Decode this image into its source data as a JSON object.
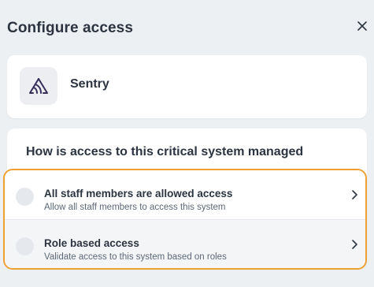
{
  "dialog": {
    "title": "Configure access"
  },
  "system": {
    "name": "Sentry",
    "logo_icon": "sentry-logo-icon"
  },
  "question": {
    "text": "How is access to this critical system managed"
  },
  "options": [
    {
      "title": "All staff members are allowed access",
      "description": "Allow all staff members to access this system",
      "selected": false
    },
    {
      "title": "Role based access",
      "description": "Validate access to this system based on roles",
      "selected": false
    }
  ],
  "colors": {
    "highlight": "#f0a031",
    "background": "#edf0f3",
    "card": "#ffffff",
    "logo": "#362d59"
  },
  "icons": [
    "close-icon",
    "sentry-logo-icon",
    "chevron-right-icon"
  ]
}
